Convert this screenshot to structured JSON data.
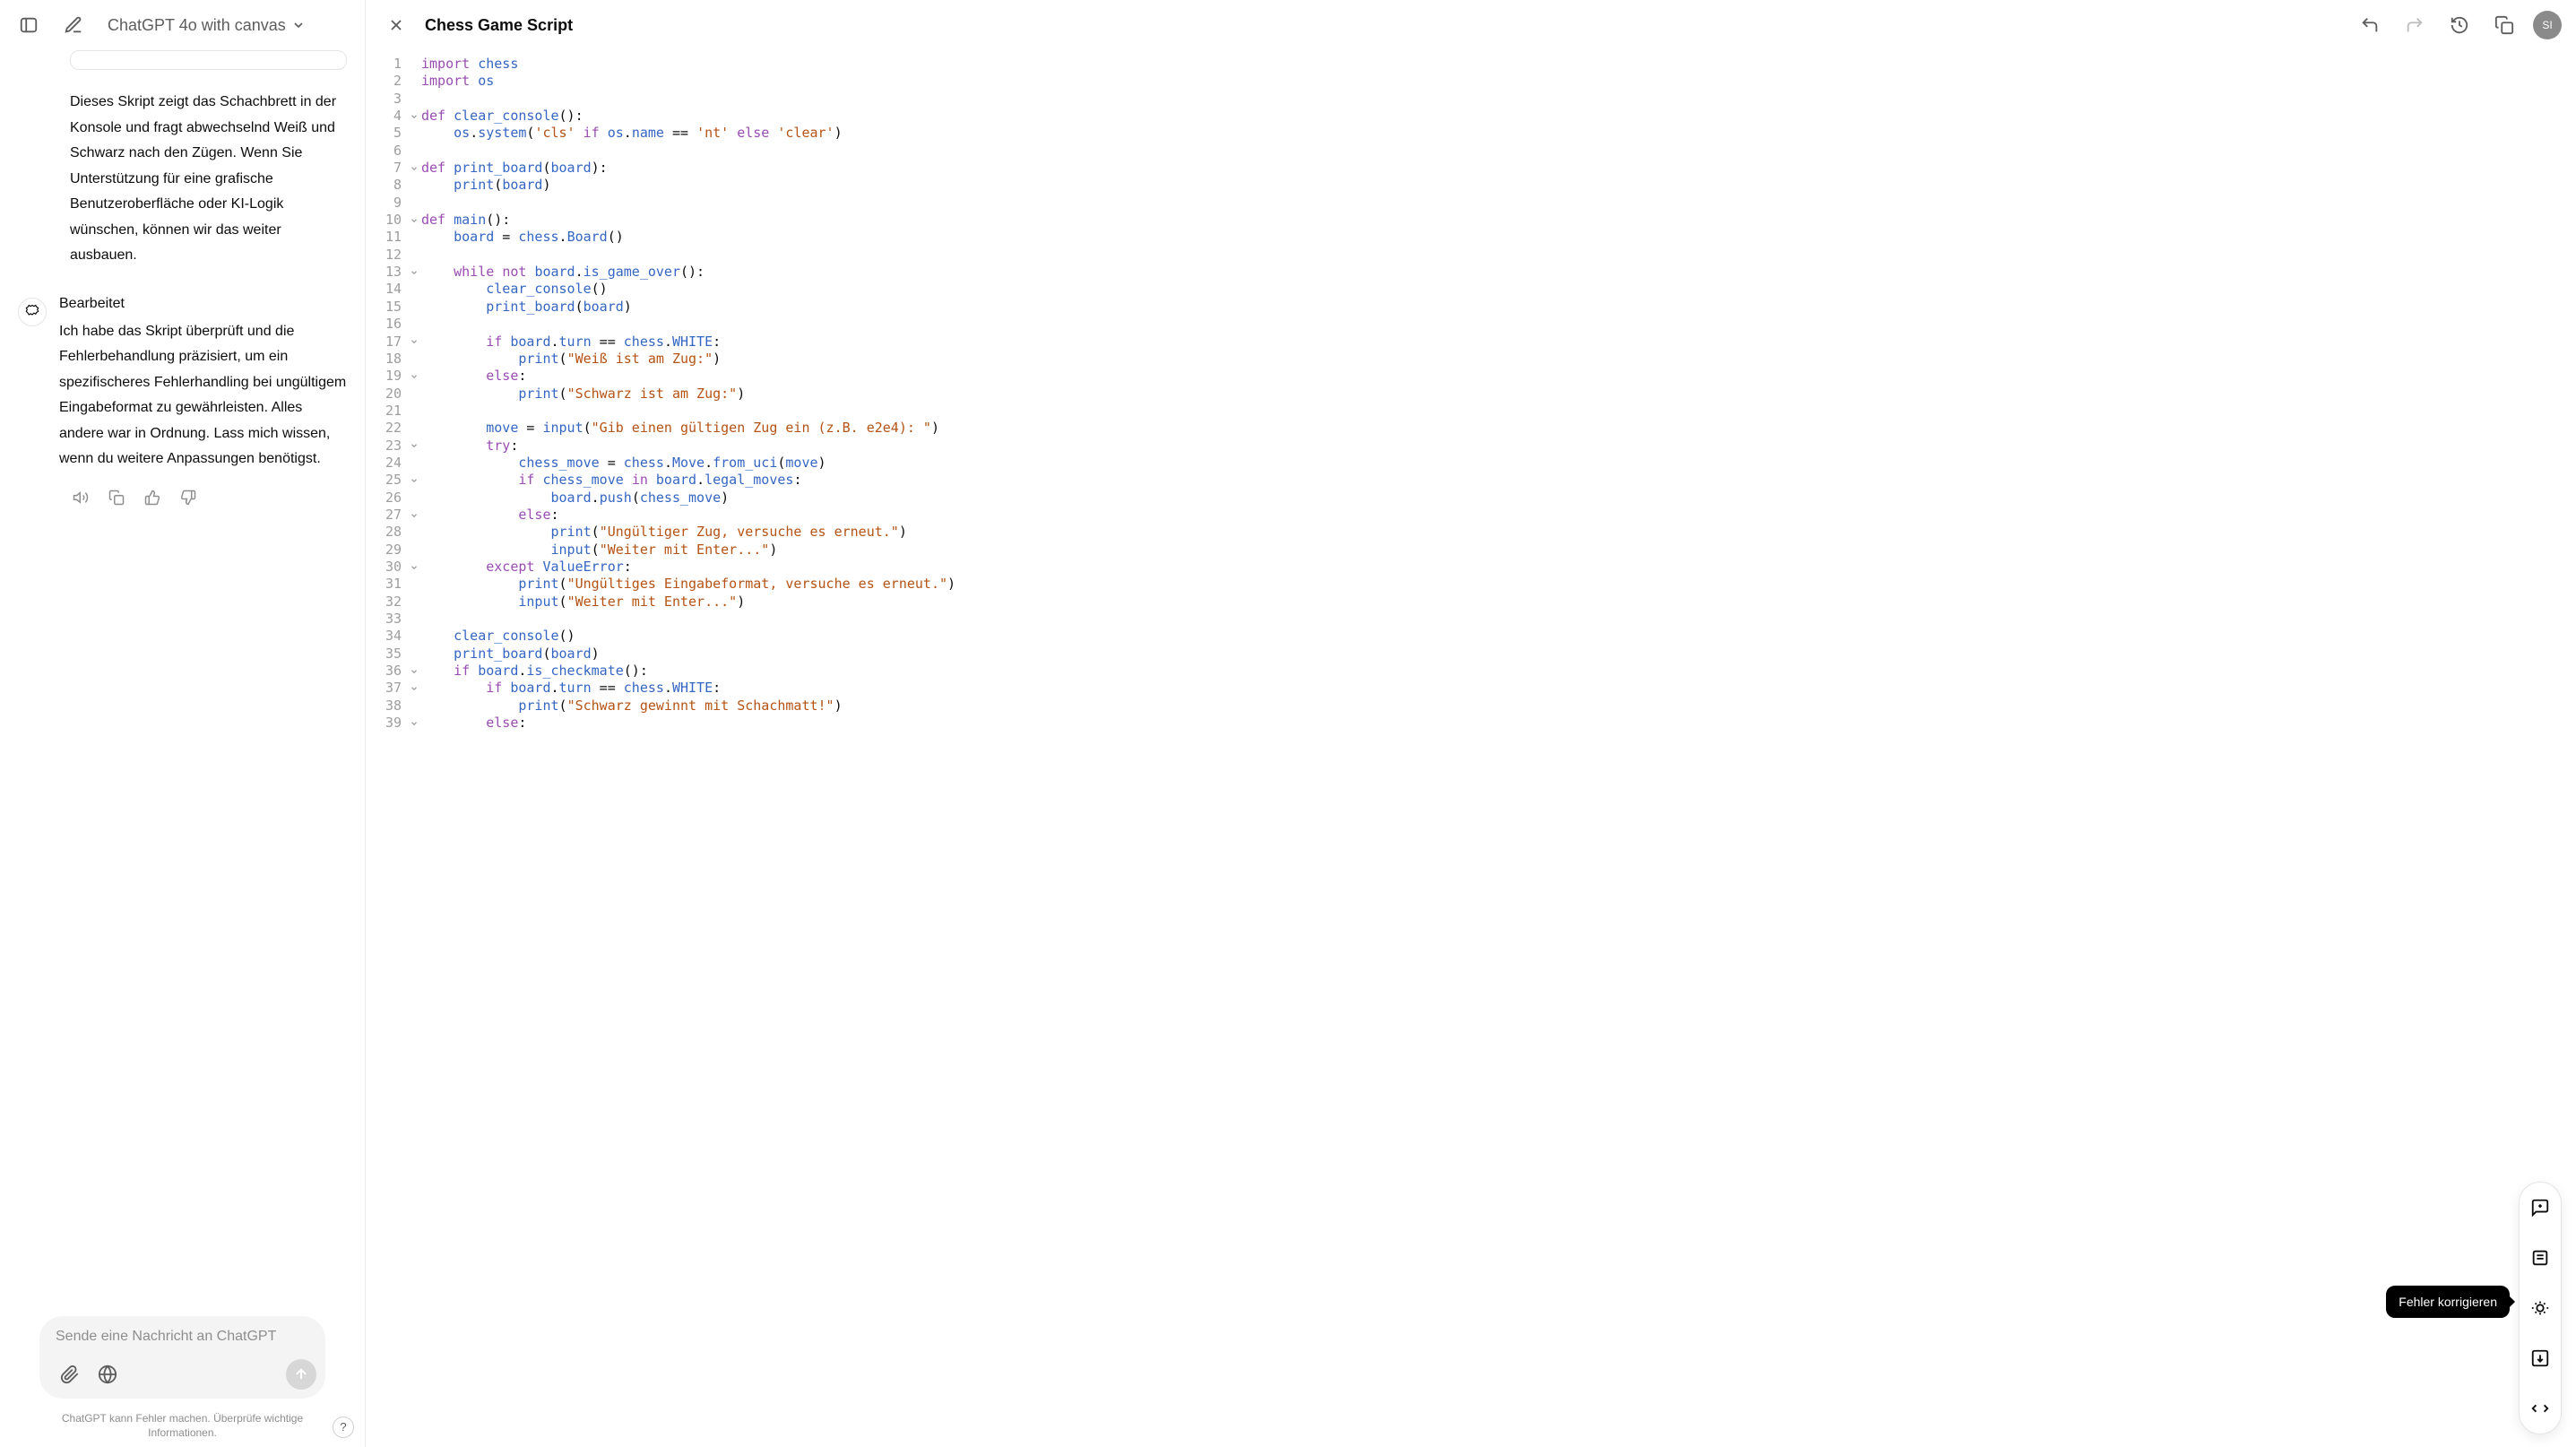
{
  "header": {
    "model": "ChatGPT 4o with canvas"
  },
  "chat": {
    "assistant1": "Dieses Skript zeigt das Schachbrett in der Konsole und fragt abwechselnd Weiß und Schwarz nach den Zügen. Wenn Sie Unterstützung für eine grafische Benutzeroberfläche oder KI-Logik wünschen, können wir das weiter ausbauen.",
    "edited_label": "Bearbeitet",
    "assistant2": "Ich habe das Skript überprüft und die Fehlerbehandlung präzisiert, um ein spezifischeres Fehlerhandling bei ungültigem Eingabeformat zu gewährleisten. Alles andere war in Ordnung. Lass mich wissen, wenn du weitere Anpassungen benötigst."
  },
  "composer": {
    "placeholder": "Sende eine Nachricht an ChatGPT"
  },
  "footer": {
    "note": "ChatGPT kann Fehler machen. Überprüfe wichtige Informationen.",
    "help": "?"
  },
  "canvas": {
    "title": "Chess Game Script",
    "avatar": "SI"
  },
  "tooltip": "Fehler korrigieren",
  "code": {
    "lines": [
      {
        "n": 1,
        "fold": "",
        "html": "<span class='kw'>import</span> <span class='fn'>chess</span>"
      },
      {
        "n": 2,
        "fold": "",
        "html": "<span class='kw'>import</span> <span class='fn'>os</span>"
      },
      {
        "n": 3,
        "fold": "",
        "html": ""
      },
      {
        "n": 4,
        "fold": "v",
        "html": "<span class='kw'>def</span> <span class='fn'>clear_console</span>():"
      },
      {
        "n": 5,
        "fold": "",
        "html": "    <span class='fn'>os</span>.<span class='fn'>system</span>(<span class='str'>'cls'</span> <span class='kw'>if</span> <span class='fn'>os</span>.<span class='fn'>name</span> == <span class='str'>'nt'</span> <span class='kw'>else</span> <span class='str'>'clear'</span>)"
      },
      {
        "n": 6,
        "fold": "",
        "html": ""
      },
      {
        "n": 7,
        "fold": "v",
        "html": "<span class='kw'>def</span> <span class='fn'>print_board</span>(<span class='fn'>board</span>):"
      },
      {
        "n": 8,
        "fold": "",
        "html": "    <span class='fn'>print</span>(<span class='fn'>board</span>)"
      },
      {
        "n": 9,
        "fold": "",
        "html": ""
      },
      {
        "n": 10,
        "fold": "v",
        "html": "<span class='kw'>def</span> <span class='fn'>main</span>():"
      },
      {
        "n": 11,
        "fold": "",
        "html": "    <span class='fn'>board</span> = <span class='fn'>chess</span>.<span class='fn'>Board</span>()"
      },
      {
        "n": 12,
        "fold": "",
        "html": ""
      },
      {
        "n": 13,
        "fold": "v",
        "html": "    <span class='kw'>while</span> <span class='kw'>not</span> <span class='fn'>board</span>.<span class='fn'>is_game_over</span>():"
      },
      {
        "n": 14,
        "fold": "",
        "html": "        <span class='fn'>clear_console</span>()"
      },
      {
        "n": 15,
        "fold": "",
        "html": "        <span class='fn'>print_board</span>(<span class='fn'>board</span>)"
      },
      {
        "n": 16,
        "fold": "",
        "html": ""
      },
      {
        "n": 17,
        "fold": "v",
        "html": "        <span class='kw'>if</span> <span class='fn'>board</span>.<span class='fn'>turn</span> == <span class='fn'>chess</span>.<span class='fn'>WHITE</span>:"
      },
      {
        "n": 18,
        "fold": "",
        "html": "            <span class='fn'>print</span>(<span class='str'>\"Weiß ist am Zug:\"</span>)"
      },
      {
        "n": 19,
        "fold": "v",
        "html": "        <span class='kw'>else</span>:"
      },
      {
        "n": 20,
        "fold": "",
        "html": "            <span class='fn'>print</span>(<span class='str'>\"Schwarz ist am Zug:\"</span>)"
      },
      {
        "n": 21,
        "fold": "",
        "html": ""
      },
      {
        "n": 22,
        "fold": "",
        "html": "        <span class='fn'>move</span> = <span class='fn'>input</span>(<span class='str'>\"Gib einen gültigen Zug ein (z.B. e2e4): \"</span>)"
      },
      {
        "n": 23,
        "fold": "v",
        "html": "        <span class='kw'>try</span>:"
      },
      {
        "n": 24,
        "fold": "",
        "html": "            <span class='fn'>chess_move</span> = <span class='fn'>chess</span>.<span class='fn'>Move</span>.<span class='fn'>from_uci</span>(<span class='fn'>move</span>)"
      },
      {
        "n": 25,
        "fold": "v",
        "html": "            <span class='kw'>if</span> <span class='fn'>chess_move</span> <span class='kw'>in</span> <span class='fn'>board</span>.<span class='fn'>legal_moves</span>:"
      },
      {
        "n": 26,
        "fold": "",
        "html": "                <span class='fn'>board</span>.<span class='fn'>push</span>(<span class='fn'>chess_move</span>)"
      },
      {
        "n": 27,
        "fold": "v",
        "html": "            <span class='kw'>else</span>:"
      },
      {
        "n": 28,
        "fold": "",
        "html": "                <span class='fn'>print</span>(<span class='str'>\"Ungültiger Zug, versuche es erneut.\"</span>)"
      },
      {
        "n": 29,
        "fold": "",
        "html": "                <span class='fn'>input</span>(<span class='str'>\"Weiter mit Enter...\"</span>)"
      },
      {
        "n": 30,
        "fold": "v",
        "html": "        <span class='kw'>except</span> <span class='fn'>ValueError</span>:"
      },
      {
        "n": 31,
        "fold": "",
        "html": "            <span class='fn'>print</span>(<span class='str'>\"Ungültiges Eingabeformat, versuche es erneut.\"</span>)"
      },
      {
        "n": 32,
        "fold": "",
        "html": "            <span class='fn'>input</span>(<span class='str'>\"Weiter mit Enter...\"</span>)"
      },
      {
        "n": 33,
        "fold": "",
        "html": ""
      },
      {
        "n": 34,
        "fold": "",
        "html": "    <span class='fn'>clear_console</span>()"
      },
      {
        "n": 35,
        "fold": "",
        "html": "    <span class='fn'>print_board</span>(<span class='fn'>board</span>)"
      },
      {
        "n": 36,
        "fold": "v",
        "html": "    <span class='kw'>if</span> <span class='fn'>board</span>.<span class='fn'>is_checkmate</span>():"
      },
      {
        "n": 37,
        "fold": "v",
        "html": "        <span class='kw'>if</span> <span class='fn'>board</span>.<span class='fn'>turn</span> == <span class='fn'>chess</span>.<span class='fn'>WHITE</span>:"
      },
      {
        "n": 38,
        "fold": "",
        "html": "            <span class='fn'>print</span>(<span class='str'>\"Schwarz gewinnt mit Schachmatt!\"</span>)"
      },
      {
        "n": 39,
        "fold": "v",
        "html": "        <span class='kw'>else</span>:"
      }
    ]
  }
}
